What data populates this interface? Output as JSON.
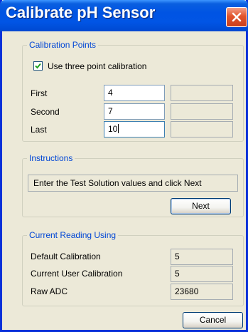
{
  "window": {
    "title": "Calibrate pH Sensor"
  },
  "calibration_points": {
    "legend": "Calibration Points",
    "three_point_checkbox": {
      "label": "Use three point calibration",
      "checked": true
    },
    "rows": [
      {
        "label": "First",
        "value": "4",
        "status": ""
      },
      {
        "label": "Second",
        "value": "7",
        "status": ""
      },
      {
        "label": "Last",
        "value": "10",
        "status": ""
      }
    ]
  },
  "instructions": {
    "legend": "Instructions",
    "text": "Enter the Test Solution values and click Next",
    "next_label": "Next"
  },
  "current_reading": {
    "legend": "Current Reading Using",
    "rows": [
      {
        "label": "Default Calibration",
        "value": "5"
      },
      {
        "label": "Current User Calibration",
        "value": "5"
      },
      {
        "label": "Raw ADC",
        "value": "23680"
      }
    ]
  },
  "footer": {
    "cancel_label": "Cancel"
  },
  "colors": {
    "title_bar": "#0054E3",
    "group_legend": "#0046D5",
    "window_face": "#ECE9D8",
    "close_button": "#E2552C"
  }
}
